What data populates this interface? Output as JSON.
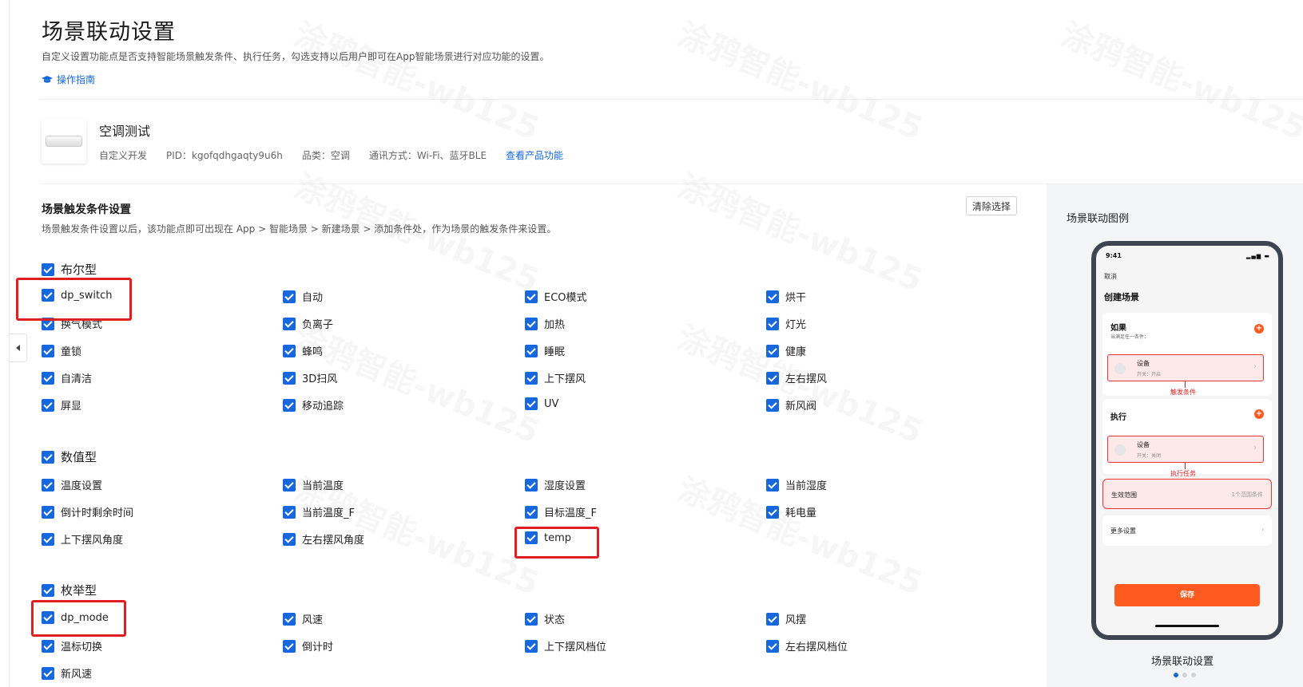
{
  "header": {
    "title": "场景联动设置",
    "description": "自定义设置功能点是否支持智能场景触发条件、执行任务，勾选支持以后用户即可在App智能场景进行对应功能的设置。",
    "guide_link": "操作指南"
  },
  "product": {
    "name": "空调测试",
    "dev_type": "自定义开发",
    "pid": "PID：kgofqdhgaqty9u6h",
    "category": "品类：空调",
    "comm": "通讯方式：Wi-Fi、蓝牙BLE",
    "view_link": "查看产品功能"
  },
  "trigger_section": {
    "title": "场景触发条件设置",
    "description": "场景触发条件设置以后，该功能点即可出现在 App > 智能场景 > 新建场景 > 添加条件处，作为场景的触发条件来设置。",
    "clear_button": "清除选择"
  },
  "groups": {
    "bool": {
      "label": "布尔型",
      "items": [
        "dp_switch",
        "自动",
        "ECO模式",
        "烘干",
        "换气模式",
        "负离子",
        "加热",
        "灯光",
        "童锁",
        "蜂鸣",
        "睡眠",
        "健康",
        "自清洁",
        "3D扫风",
        "上下摆风",
        "左右摆风",
        "屏显",
        "移动追踪",
        "UV",
        "新风阀"
      ]
    },
    "value": {
      "label": "数值型",
      "items": [
        "温度设置",
        "当前温度",
        "湿度设置",
        "当前湿度",
        "倒计时剩余时间",
        "当前温度_F",
        "目标温度_F",
        "耗电量",
        "上下摆风角度",
        "左右摆风角度",
        "temp"
      ]
    },
    "enum": {
      "label": "枚举型",
      "items": [
        "dp_mode",
        "风速",
        "状态",
        "风摆",
        "温标切换",
        "倒计时",
        "上下摆风档位",
        "左右摆风档位",
        "新风速"
      ]
    }
  },
  "preview": {
    "title": "场景联动图例",
    "caption": "场景联动设置",
    "phone": {
      "time": "9:41",
      "cancel": "取消",
      "create": "创建场景",
      "if_title": "如果",
      "if_sub": "当满足任一条件：",
      "device1_name": "设备",
      "device1_value": "开关：开启",
      "trigger_note": "触发条件",
      "exec_title": "执行",
      "device2_name": "设备",
      "device2_value": "开关：关闭",
      "exec_note": "执行任务",
      "scope_label": "生效范围",
      "scope_value": "1个范围条件",
      "more_label": "更多设置",
      "save_button": "保存"
    }
  },
  "watermark": "涂鸦智能-wb125",
  "colors": {
    "accent": "#1668dc",
    "highlight": "#e02020",
    "save": "#ff5a1f"
  }
}
